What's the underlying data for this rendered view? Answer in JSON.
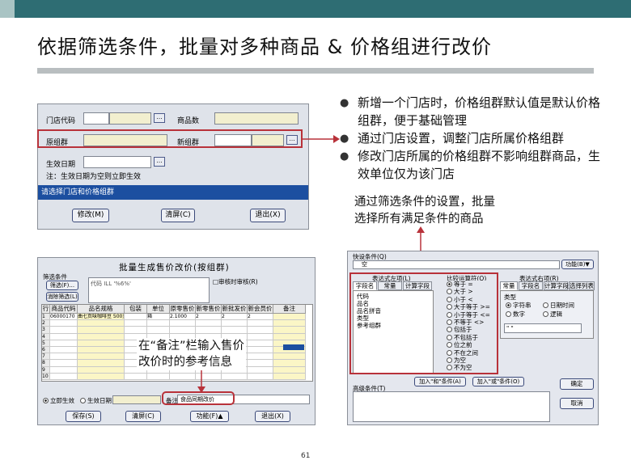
{
  "slide": {
    "title": "依据筛选条件，批量对多种商品 & 价格组进行改价",
    "page_number": "61"
  },
  "bullets": [
    "新增一个门店时，价格组群默认值是默认价格组群，便于基础管理",
    "通过门店设置，调整门店所属价格组群",
    "修改门店所属的价格组群不影响组群商品，生效单位仅为该门店"
  ],
  "notes": {
    "filter_note": [
      "通过筛选条件的设置，批量",
      "选择所有满足条件的商品"
    ],
    "remark_note": [
      "在“备注”栏输入售价",
      "改价时的参考信息"
    ]
  },
  "store_dialog": {
    "store_code_label": "门店代码",
    "item_count_label": "商品数",
    "orig_group_label": "原组群",
    "new_group_label": "新组群",
    "effective_date_label": "生效日期",
    "hint": "注：生效日期为空则立即生效",
    "status_bar": "请选择门店和价格组群",
    "modify_button": "修改(M)",
    "clear_button": "清屏(C)",
    "exit_button": "退出(X)",
    "dots": "..."
  },
  "batch_window": {
    "title": "批量生成售价改价(按组群)",
    "filter_cond_label": "筛选条件",
    "filter_button": "筛选(F)...",
    "cancel_filter_button": "消除筛选(L)",
    "condition_text": "代码 ILL '%6%'",
    "recheck_label": "□审核时审核(R)",
    "columns": [
      "行",
      "商品代码",
      "品名规格",
      "包装",
      "单位",
      "原零售价",
      "新零售价",
      "新批发价",
      "新会员价",
      "备注"
    ],
    "rows": [
      {
        "no": "1",
        "code": "06000170",
        "name": "曲七页味咖啡豆 500克 S61F",
        "pack": "",
        "unit": "箱",
        "old_price": "2.1000",
        "new_retail": "2",
        "new_whole": "2",
        "new_member": "2"
      },
      {
        "no": "2",
        "code": "",
        "name": "",
        "pack": "",
        "unit": "",
        "old_price": "",
        "new_retail": "",
        "new_whole": "",
        "new_member": ""
      },
      {
        "no": "3",
        "code": "",
        "name": "",
        "pack": "",
        "unit": "",
        "old_price": "",
        "new_retail": "",
        "new_whole": "",
        "new_member": ""
      },
      {
        "no": "4",
        "code": "",
        "name": "",
        "pack": "",
        "unit": "",
        "old_price": "",
        "new_retail": "",
        "new_whole": "",
        "new_member": ""
      },
      {
        "no": "5",
        "code": "",
        "name": "",
        "pack": "",
        "unit": "",
        "old_price": "",
        "new_retail": "",
        "new_whole": "",
        "new_member": ""
      },
      {
        "no": "6",
        "code": "",
        "name": "",
        "pack": "",
        "unit": "",
        "old_price": "",
        "new_retail": "",
        "new_whole": "",
        "new_member": ""
      },
      {
        "no": "7",
        "code": "",
        "name": "",
        "pack": "",
        "unit": "",
        "old_price": "",
        "new_retail": "",
        "new_whole": "",
        "new_member": ""
      },
      {
        "no": "8",
        "code": "",
        "name": "",
        "pack": "",
        "unit": "",
        "old_price": "",
        "new_retail": "",
        "new_whole": "",
        "new_member": ""
      },
      {
        "no": "9",
        "code": "",
        "name": "",
        "pack": "",
        "unit": "",
        "old_price": "",
        "new_retail": "",
        "new_whole": "",
        "new_member": ""
      },
      {
        "no": "10",
        "code": "",
        "name": "",
        "pack": "",
        "unit": "",
        "old_price": "",
        "new_retail": "",
        "new_whole": "",
        "new_member": ""
      }
    ],
    "immediate_label": "立即生效",
    "effective_date_label": "生效日期",
    "remark_label": "备注",
    "remark_value": "食品同期改价",
    "save_button": "保存(S)",
    "clear_button": "清屏(C)",
    "function_button": "功能(F)▲",
    "exit_button": "退出(X)"
  },
  "filter_window": {
    "quick_set_label": "快设条件(Q)",
    "quick_value": "空",
    "function_button": "功能(B)▼",
    "expr_left_label": "表达式左项(L)",
    "compare_label": "比较运算符(O)",
    "expr_right_label": "表达式右项(R)",
    "left_tabs": [
      "字段名",
      "常量",
      "计算字段"
    ],
    "left_items": [
      "代码",
      "品名",
      "品名拼音",
      "类型",
      "参考组群"
    ],
    "operators": [
      "等于 =",
      "大于 >",
      "小于 <",
      "大于等于 >=",
      "小于等于 <=",
      "不等于 <>",
      "包括于",
      "不包括于",
      "位之前",
      "不在之间",
      "为空",
      "不为空"
    ],
    "right_tabs": [
      "常量",
      "字段名",
      "计算字段",
      "选择列表"
    ],
    "type_label": "类型",
    "type_options": [
      "字符串",
      "日期时间",
      "数字",
      "逻辑"
    ],
    "right_value": "\"                              \"",
    "add_and_button": "加入\"和\"条件(A)",
    "add_or_button": "加入\"或\"条件(O)",
    "confirm_button": "确定",
    "cancel_button": "取消",
    "current_cond_label": "高级条件(T)"
  }
}
